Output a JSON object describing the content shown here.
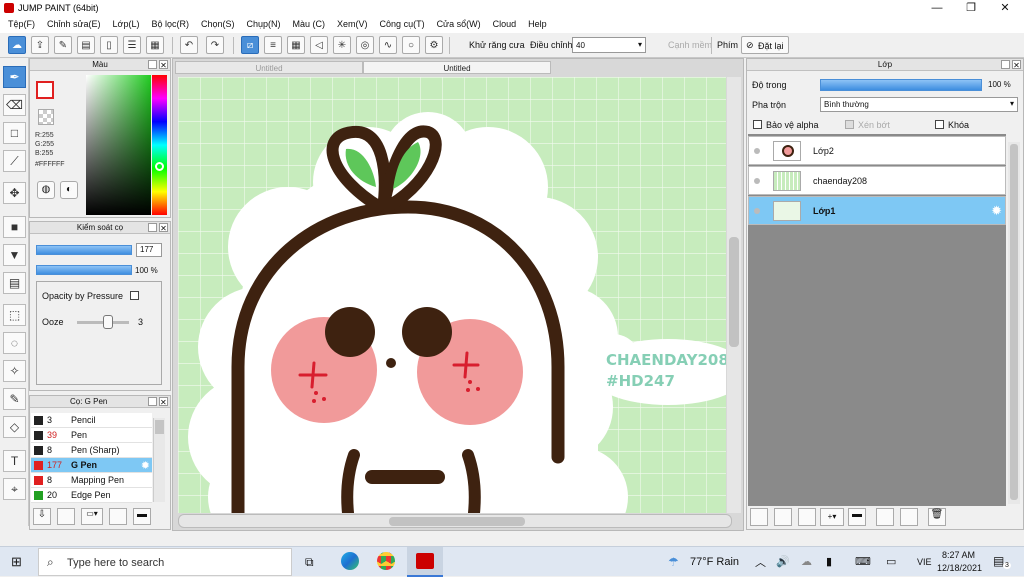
{
  "window": {
    "title": "JUMP PAINT (64bit)",
    "controls": [
      "—",
      "❐",
      "✕"
    ]
  },
  "menu": [
    "Tệp(F)",
    "Chỉnh sửa(E)",
    "Lớp(L)",
    "Bộ lọc(R)",
    "Chọn(S)",
    "Chụp(N)",
    "Màu (C)",
    "Xem(V)",
    "Công cụ(T)",
    "Cửa sổ(W)",
    "Cloud",
    "Help"
  ],
  "toolbar": {
    "antialias_label": "Khử răng cưa",
    "adjust_label": "Điều chỉnh",
    "adjust_value": "40",
    "smooth_edge_label": "Cạnh mềm",
    "keys_label": "Phím",
    "reset_label": "Đặt lại"
  },
  "color_panel": {
    "title": "Màu",
    "r": "R:255",
    "g": "G:255",
    "b": "B:255",
    "hex": "#FFFFFF",
    "fg_color": "#e02020",
    "bg_color": "#ffffff"
  },
  "brush_panel": {
    "title": "Kiểm soát cọ",
    "size_value": "177",
    "opacity_value": "100 %",
    "opacity_pressure_label": "Opacity by Pressure",
    "ooze_label": "Ooze",
    "ooze_value": "3"
  },
  "pen_panel": {
    "title": "Cọ: G Pen",
    "items": [
      {
        "size": "3",
        "name": "Pencil",
        "color": "#222222",
        "red": false
      },
      {
        "size": "39",
        "name": "Pen",
        "color": "#222222",
        "red": true
      },
      {
        "size": "8",
        "name": "Pen (Sharp)",
        "color": "#222222",
        "red": false
      },
      {
        "size": "177",
        "name": "G Pen",
        "color": "#e02020",
        "red": true
      },
      {
        "size": "8",
        "name": "Mapping Pen",
        "color": "#e02020",
        "red": false
      },
      {
        "size": "20",
        "name": "Edge Pen",
        "color": "#22a022",
        "red": false
      }
    ]
  },
  "documents": {
    "tabs": [
      "Untitled",
      "Untitled"
    ]
  },
  "artwork": {
    "line1": "CHAENDAY208",
    "line2": "#HD247"
  },
  "layer_panel": {
    "title": "Lớp",
    "opacity_label": "Độ trong",
    "opacity_value": "100 %",
    "blend_label": "Pha trộn",
    "blend_value": "Bình thường",
    "protect_alpha_label": "Bảo vệ alpha",
    "clip_label": "Xén bớt",
    "lock_label": "Khóa",
    "layers": [
      {
        "name": "Lớp2",
        "selected": false
      },
      {
        "name": "chaenday208",
        "selected": false
      },
      {
        "name": "Lớp1",
        "selected": true
      }
    ]
  },
  "taskbar": {
    "search_placeholder": "Type here to search",
    "weather": "77°F  Rain",
    "lang": "VIE",
    "time": "8:27 AM",
    "date": "12/18/2021",
    "notif_count": "3"
  }
}
